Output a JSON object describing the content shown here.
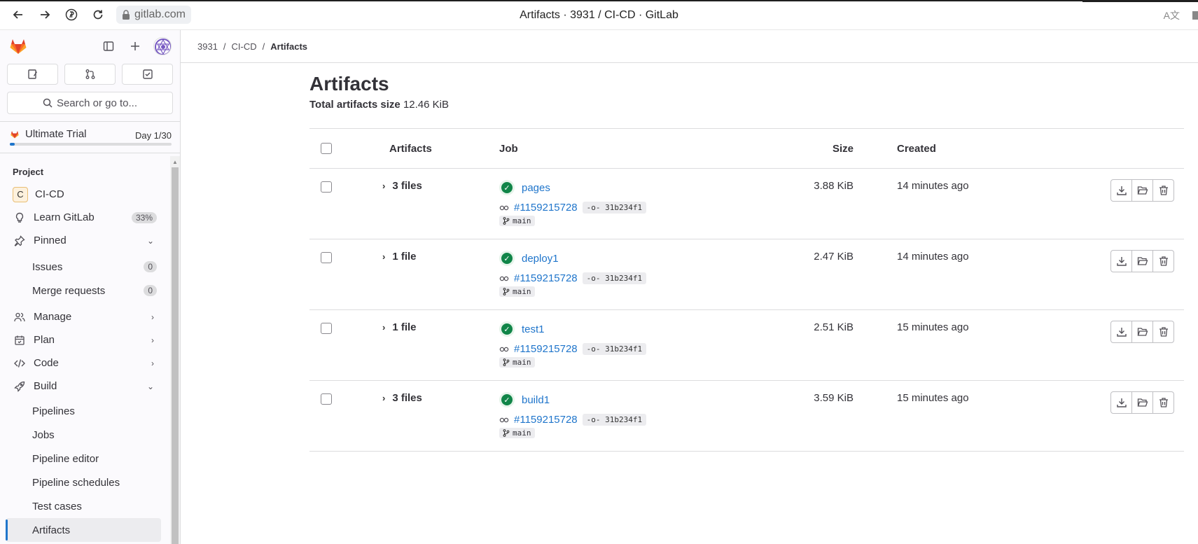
{
  "browser": {
    "url": "gitlab.com",
    "title": "Artifacts · 3931 / CI-CD · GitLab"
  },
  "sidebar": {
    "counts": [
      "issues-icon",
      "merge-request-icon",
      "todo-icon"
    ],
    "search_placeholder": "Search or go to...",
    "trial": {
      "label": "Ultimate Trial",
      "day": "Day 1/30",
      "progress": 0.03
    },
    "section_label": "Project",
    "project": {
      "initial": "C",
      "name": "CI-CD"
    },
    "learn": {
      "label": "Learn GitLab",
      "badge": "33%"
    },
    "pinned": {
      "label": "Pinned",
      "items": [
        {
          "label": "Issues",
          "count": "0"
        },
        {
          "label": "Merge requests",
          "count": "0"
        }
      ]
    },
    "groups": [
      {
        "label": "Manage"
      },
      {
        "label": "Plan"
      },
      {
        "label": "Code"
      }
    ],
    "build": {
      "label": "Build",
      "items": [
        {
          "label": "Pipelines"
        },
        {
          "label": "Jobs"
        },
        {
          "label": "Pipeline editor"
        },
        {
          "label": "Pipeline schedules"
        },
        {
          "label": "Test cases"
        },
        {
          "label": "Artifacts"
        }
      ]
    }
  },
  "breadcrumb": [
    "3931",
    "CI-CD",
    "Artifacts"
  ],
  "page": {
    "title": "Artifacts",
    "total_label": "Total artifacts size",
    "total_value": "12.46 KiB"
  },
  "table": {
    "headers": {
      "artifacts": "Artifacts",
      "job": "Job",
      "size": "Size",
      "created": "Created"
    },
    "rows": [
      {
        "files": "3 files",
        "job": "pages",
        "pipeline": "#1159215728",
        "sha": "31b234f1",
        "branch": "main",
        "size": "3.88 KiB",
        "created": "14 minutes ago"
      },
      {
        "files": "1 file",
        "job": "deploy1",
        "pipeline": "#1159215728",
        "sha": "31b234f1",
        "branch": "main",
        "size": "2.47 KiB",
        "created": "14 minutes ago"
      },
      {
        "files": "1 file",
        "job": "test1",
        "pipeline": "#1159215728",
        "sha": "31b234f1",
        "branch": "main",
        "size": "2.51 KiB",
        "created": "15 minutes ago"
      },
      {
        "files": "3 files",
        "job": "build1",
        "pipeline": "#1159215728",
        "sha": "31b234f1",
        "branch": "main",
        "size": "3.59 KiB",
        "created": "15 minutes ago"
      }
    ]
  }
}
